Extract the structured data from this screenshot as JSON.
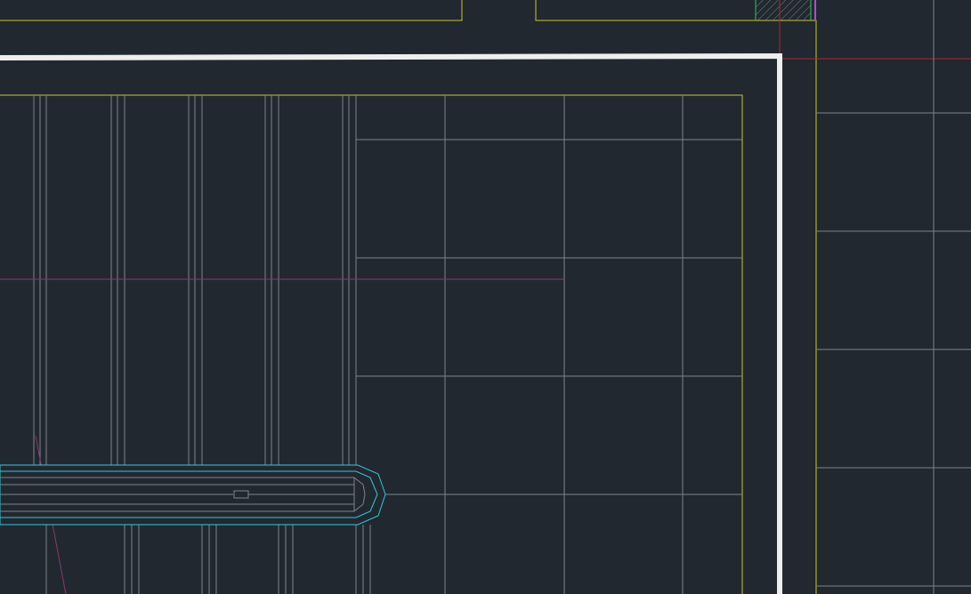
{
  "drawing": {
    "background": "#212830",
    "colors": {
      "boundary_line": "#e8e8e8",
      "yellow_layer": "#c8c82a",
      "grid_layer": "#7e848c",
      "cyan_layer": "#34c8d8",
      "magenta_layer": "#8a3a6e",
      "red_layer": "#b02828",
      "green_layer": "#2ec84a",
      "purple_layer": "#b04cc8",
      "hatch_pattern": "#7e848c"
    },
    "layers": [
      "boundary",
      "yellow",
      "grid",
      "cyan",
      "magenta",
      "red",
      "hatch"
    ]
  }
}
